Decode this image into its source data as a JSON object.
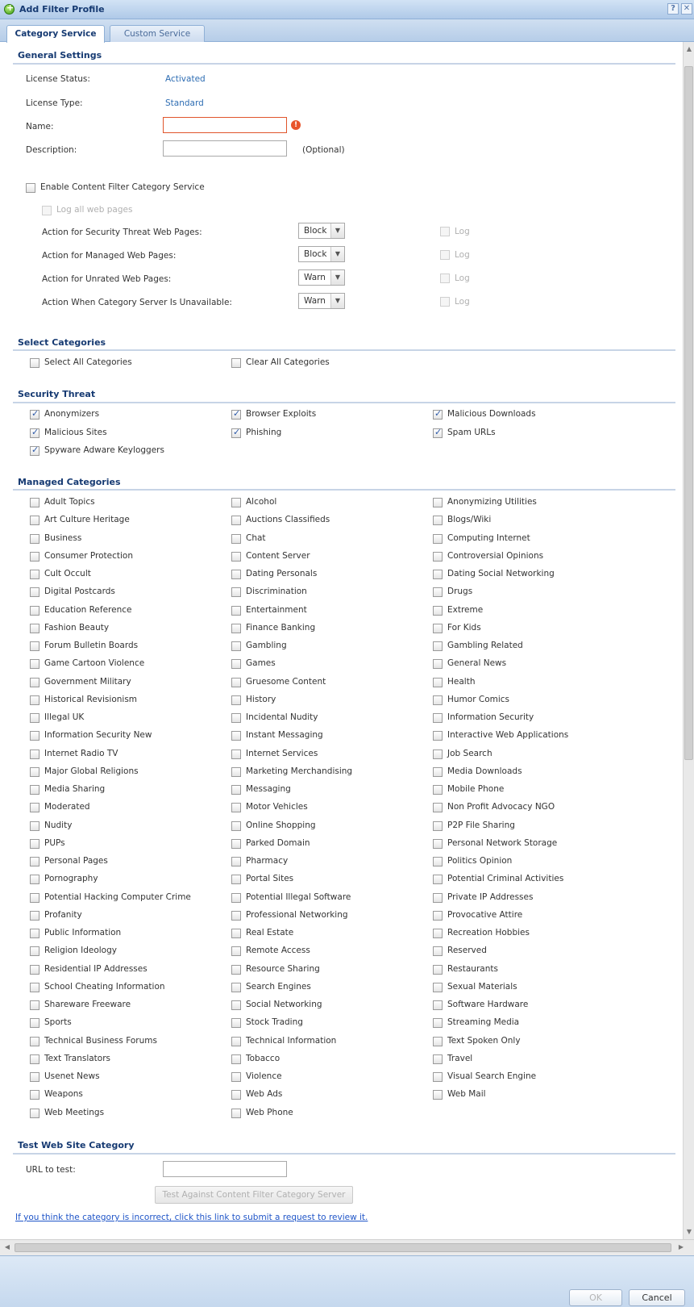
{
  "window": {
    "title": "Add Filter Profile",
    "help_icon": "?",
    "close_icon": "✕"
  },
  "tabs": [
    {
      "label": "Category Service",
      "active": true
    },
    {
      "label": "Custom Service",
      "active": false
    }
  ],
  "general": {
    "heading": "General Settings",
    "license_status_label": "License Status:",
    "license_status": "Activated",
    "license_type_label": "License Type:",
    "license_type": "Standard",
    "name_label": "Name:",
    "name_value": "",
    "description_label": "Description:",
    "description_value": "",
    "optional": "(Optional)",
    "enable_label": "Enable Content Filter Category Service",
    "log_all_label": "Log all web pages",
    "actions": [
      {
        "label": "Action for Security Threat Web Pages:",
        "value": "Block",
        "log": "Log"
      },
      {
        "label": "Action for Managed Web Pages:",
        "value": "Block",
        "log": "Log"
      },
      {
        "label": "Action for Unrated Web Pages:",
        "value": "Warn",
        "log": "Log"
      },
      {
        "label": "Action When Category Server Is Unavailable:",
        "value": "Warn",
        "log": "Log"
      }
    ]
  },
  "select_categories": {
    "heading": "Select Categories",
    "select_all": "Select All Categories",
    "clear_all": "Clear All Categories"
  },
  "security_threat": {
    "heading": "Security Threat",
    "items": [
      "Anonymizers",
      "Browser Exploits",
      "Malicious Downloads",
      "Malicious Sites",
      "Phishing",
      "Spam URLs",
      "Spyware Adware Keyloggers"
    ]
  },
  "managed": {
    "heading": "Managed Categories",
    "items": [
      "Adult Topics",
      "Alcohol",
      "Anonymizing Utilities",
      "Art Culture Heritage",
      "Auctions Classifieds",
      "Blogs/Wiki",
      "Business",
      "Chat",
      "Computing Internet",
      "Consumer Protection",
      "Content Server",
      "Controversial Opinions",
      "Cult Occult",
      "Dating Personals",
      "Dating Social Networking",
      "Digital Postcards",
      "Discrimination",
      "Drugs",
      "Education Reference",
      "Entertainment",
      "Extreme",
      "Fashion Beauty",
      "Finance Banking",
      "For Kids",
      "Forum Bulletin Boards",
      "Gambling",
      "Gambling Related",
      "Game Cartoon Violence",
      "Games",
      "General News",
      "Government Military",
      "Gruesome Content",
      "Health",
      "Historical Revisionism",
      "History",
      "Humor Comics",
      "Illegal UK",
      "Incidental Nudity",
      "Information Security",
      "Information Security New",
      "Instant Messaging",
      "Interactive Web Applications",
      "Internet Radio TV",
      "Internet Services",
      "Job Search",
      "Major Global Religions",
      "Marketing Merchandising",
      "Media Downloads",
      "Media Sharing",
      "Messaging",
      "Mobile Phone",
      "Moderated",
      "Motor Vehicles",
      "Non Profit Advocacy NGO",
      "Nudity",
      "Online Shopping",
      "P2P File Sharing",
      "PUPs",
      "Parked Domain",
      "Personal Network Storage",
      "Personal Pages",
      "Pharmacy",
      "Politics Opinion",
      "Pornography",
      "Portal Sites",
      "Potential Criminal Activities",
      "Potential Hacking Computer Crime",
      "Potential Illegal Software",
      "Private IP Addresses",
      "Profanity",
      "Professional Networking",
      "Provocative Attire",
      "Public Information",
      "Real Estate",
      "Recreation Hobbies",
      "Religion Ideology",
      "Remote Access",
      "Reserved",
      "Residential IP Addresses",
      "Resource Sharing",
      "Restaurants",
      "School Cheating Information",
      "Search Engines",
      "Sexual Materials",
      "Shareware Freeware",
      "Social Networking",
      "Software Hardware",
      "Sports",
      "Stock Trading",
      "Streaming Media",
      "Technical Business Forums",
      "Technical Information",
      "Text Spoken Only",
      "Text Translators",
      "Tobacco",
      "Travel",
      "Usenet News",
      "Violence",
      "Visual Search Engine",
      "Weapons",
      "Web Ads",
      "Web Mail",
      "Web Meetings",
      "Web Phone"
    ]
  },
  "test": {
    "heading": "Test Web Site Category",
    "url_label": "URL to test:",
    "url_value": "",
    "button": "Test Against Content Filter Category Server",
    "link": "If you think the category is incorrect, click this link to submit a request to review it."
  },
  "footer": {
    "ok": "OK",
    "cancel": "Cancel"
  }
}
